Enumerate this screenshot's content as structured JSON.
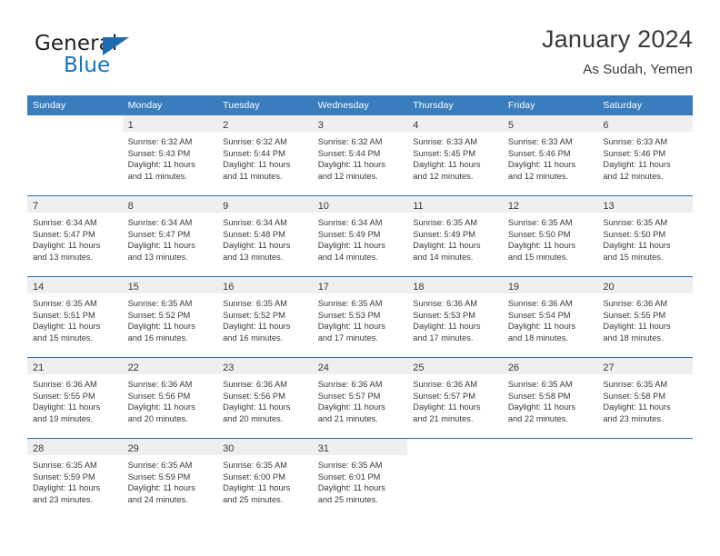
{
  "brand": {
    "name_part1": "General",
    "name_part2": "Blue",
    "flag_icon": "triangle-flag-icon",
    "accent_color": "#1673bd"
  },
  "header": {
    "title": "January 2024",
    "location": "As Sudah, Yemen"
  },
  "theme": {
    "header_blue": "#3a7dbf",
    "separator_blue": "#2e6da4",
    "daynum_band": "#efefef",
    "text": "#3a3a3a"
  },
  "weekday_headers": [
    "Sunday",
    "Monday",
    "Tuesday",
    "Wednesday",
    "Thursday",
    "Friday",
    "Saturday"
  ],
  "weeks": [
    [
      {
        "empty": true
      },
      {
        "day": "1",
        "sunrise": "Sunrise: 6:32 AM",
        "sunset": "Sunset: 5:43 PM",
        "daylight_line1": "Daylight: 11 hours",
        "daylight_line2": "and 11 minutes."
      },
      {
        "day": "2",
        "sunrise": "Sunrise: 6:32 AM",
        "sunset": "Sunset: 5:44 PM",
        "daylight_line1": "Daylight: 11 hours",
        "daylight_line2": "and 11 minutes."
      },
      {
        "day": "3",
        "sunrise": "Sunrise: 6:32 AM",
        "sunset": "Sunset: 5:44 PM",
        "daylight_line1": "Daylight: 11 hours",
        "daylight_line2": "and 12 minutes."
      },
      {
        "day": "4",
        "sunrise": "Sunrise: 6:33 AM",
        "sunset": "Sunset: 5:45 PM",
        "daylight_line1": "Daylight: 11 hours",
        "daylight_line2": "and 12 minutes."
      },
      {
        "day": "5",
        "sunrise": "Sunrise: 6:33 AM",
        "sunset": "Sunset: 5:46 PM",
        "daylight_line1": "Daylight: 11 hours",
        "daylight_line2": "and 12 minutes."
      },
      {
        "day": "6",
        "sunrise": "Sunrise: 6:33 AM",
        "sunset": "Sunset: 5:46 PM",
        "daylight_line1": "Daylight: 11 hours",
        "daylight_line2": "and 12 minutes."
      }
    ],
    [
      {
        "day": "7",
        "sunrise": "Sunrise: 6:34 AM",
        "sunset": "Sunset: 5:47 PM",
        "daylight_line1": "Daylight: 11 hours",
        "daylight_line2": "and 13 minutes."
      },
      {
        "day": "8",
        "sunrise": "Sunrise: 6:34 AM",
        "sunset": "Sunset: 5:47 PM",
        "daylight_line1": "Daylight: 11 hours",
        "daylight_line2": "and 13 minutes."
      },
      {
        "day": "9",
        "sunrise": "Sunrise: 6:34 AM",
        "sunset": "Sunset: 5:48 PM",
        "daylight_line1": "Daylight: 11 hours",
        "daylight_line2": "and 13 minutes."
      },
      {
        "day": "10",
        "sunrise": "Sunrise: 6:34 AM",
        "sunset": "Sunset: 5:49 PM",
        "daylight_line1": "Daylight: 11 hours",
        "daylight_line2": "and 14 minutes."
      },
      {
        "day": "11",
        "sunrise": "Sunrise: 6:35 AM",
        "sunset": "Sunset: 5:49 PM",
        "daylight_line1": "Daylight: 11 hours",
        "daylight_line2": "and 14 minutes."
      },
      {
        "day": "12",
        "sunrise": "Sunrise: 6:35 AM",
        "sunset": "Sunset: 5:50 PM",
        "daylight_line1": "Daylight: 11 hours",
        "daylight_line2": "and 15 minutes."
      },
      {
        "day": "13",
        "sunrise": "Sunrise: 6:35 AM",
        "sunset": "Sunset: 5:50 PM",
        "daylight_line1": "Daylight: 11 hours",
        "daylight_line2": "and 15 minutes."
      }
    ],
    [
      {
        "day": "14",
        "sunrise": "Sunrise: 6:35 AM",
        "sunset": "Sunset: 5:51 PM",
        "daylight_line1": "Daylight: 11 hours",
        "daylight_line2": "and 15 minutes."
      },
      {
        "day": "15",
        "sunrise": "Sunrise: 6:35 AM",
        "sunset": "Sunset: 5:52 PM",
        "daylight_line1": "Daylight: 11 hours",
        "daylight_line2": "and 16 minutes."
      },
      {
        "day": "16",
        "sunrise": "Sunrise: 6:35 AM",
        "sunset": "Sunset: 5:52 PM",
        "daylight_line1": "Daylight: 11 hours",
        "daylight_line2": "and 16 minutes."
      },
      {
        "day": "17",
        "sunrise": "Sunrise: 6:35 AM",
        "sunset": "Sunset: 5:53 PM",
        "daylight_line1": "Daylight: 11 hours",
        "daylight_line2": "and 17 minutes."
      },
      {
        "day": "18",
        "sunrise": "Sunrise: 6:36 AM",
        "sunset": "Sunset: 5:53 PM",
        "daylight_line1": "Daylight: 11 hours",
        "daylight_line2": "and 17 minutes."
      },
      {
        "day": "19",
        "sunrise": "Sunrise: 6:36 AM",
        "sunset": "Sunset: 5:54 PM",
        "daylight_line1": "Daylight: 11 hours",
        "daylight_line2": "and 18 minutes."
      },
      {
        "day": "20",
        "sunrise": "Sunrise: 6:36 AM",
        "sunset": "Sunset: 5:55 PM",
        "daylight_line1": "Daylight: 11 hours",
        "daylight_line2": "and 18 minutes."
      }
    ],
    [
      {
        "day": "21",
        "sunrise": "Sunrise: 6:36 AM",
        "sunset": "Sunset: 5:55 PM",
        "daylight_line1": "Daylight: 11 hours",
        "daylight_line2": "and 19 minutes."
      },
      {
        "day": "22",
        "sunrise": "Sunrise: 6:36 AM",
        "sunset": "Sunset: 5:56 PM",
        "daylight_line1": "Daylight: 11 hours",
        "daylight_line2": "and 20 minutes."
      },
      {
        "day": "23",
        "sunrise": "Sunrise: 6:36 AM",
        "sunset": "Sunset: 5:56 PM",
        "daylight_line1": "Daylight: 11 hours",
        "daylight_line2": "and 20 minutes."
      },
      {
        "day": "24",
        "sunrise": "Sunrise: 6:36 AM",
        "sunset": "Sunset: 5:57 PM",
        "daylight_line1": "Daylight: 11 hours",
        "daylight_line2": "and 21 minutes."
      },
      {
        "day": "25",
        "sunrise": "Sunrise: 6:36 AM",
        "sunset": "Sunset: 5:57 PM",
        "daylight_line1": "Daylight: 11 hours",
        "daylight_line2": "and 21 minutes."
      },
      {
        "day": "26",
        "sunrise": "Sunrise: 6:35 AM",
        "sunset": "Sunset: 5:58 PM",
        "daylight_line1": "Daylight: 11 hours",
        "daylight_line2": "and 22 minutes."
      },
      {
        "day": "27",
        "sunrise": "Sunrise: 6:35 AM",
        "sunset": "Sunset: 5:58 PM",
        "daylight_line1": "Daylight: 11 hours",
        "daylight_line2": "and 23 minutes."
      }
    ],
    [
      {
        "day": "28",
        "sunrise": "Sunrise: 6:35 AM",
        "sunset": "Sunset: 5:59 PM",
        "daylight_line1": "Daylight: 11 hours",
        "daylight_line2": "and 23 minutes."
      },
      {
        "day": "29",
        "sunrise": "Sunrise: 6:35 AM",
        "sunset": "Sunset: 5:59 PM",
        "daylight_line1": "Daylight: 11 hours",
        "daylight_line2": "and 24 minutes."
      },
      {
        "day": "30",
        "sunrise": "Sunrise: 6:35 AM",
        "sunset": "Sunset: 6:00 PM",
        "daylight_line1": "Daylight: 11 hours",
        "daylight_line2": "and 25 minutes."
      },
      {
        "day": "31",
        "sunrise": "Sunrise: 6:35 AM",
        "sunset": "Sunset: 6:01 PM",
        "daylight_line1": "Daylight: 11 hours",
        "daylight_line2": "and 25 minutes."
      },
      {
        "empty": true
      },
      {
        "empty": true
      },
      {
        "empty": true
      }
    ]
  ]
}
